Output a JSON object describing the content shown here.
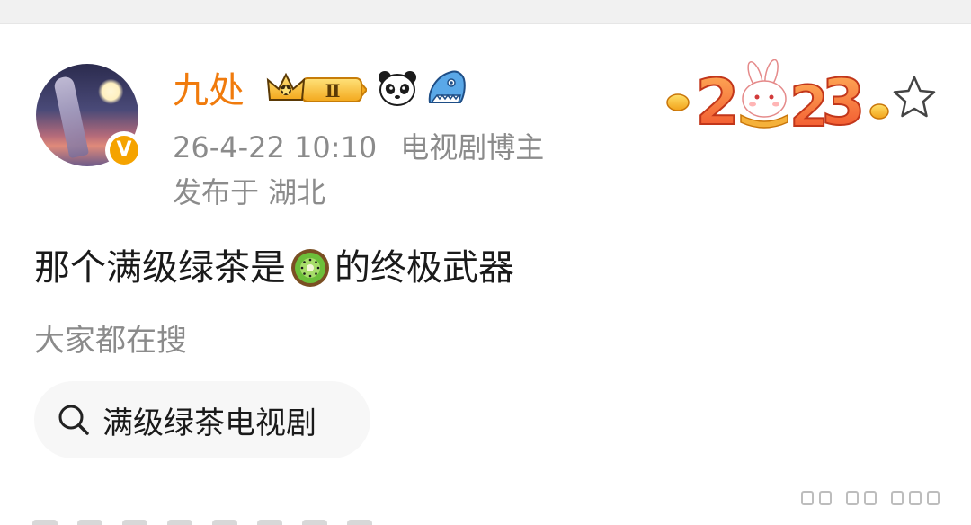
{
  "post": {
    "author": {
      "name": "九处",
      "verified_mark": "V",
      "level_badge": "Ⅱ"
    },
    "meta": {
      "timestamp": "26-4-22 10:10",
      "role": "电视剧博主",
      "location": "发布于 湖北"
    },
    "year_badge": "2023",
    "content": {
      "text_before": "那个满级绿茶是",
      "emoji": "kiwi-emoji",
      "text_after": "的终极武器"
    },
    "trending": {
      "label": "大家都在搜",
      "search_item": "满级绿茶电视剧"
    }
  },
  "icons": {
    "avatar": "avatar-image",
    "verified": "verified-badge-icon",
    "crown": "crown-badge-icon",
    "panda": "panda-icon",
    "shark": "shark-icon",
    "anniversary": "rabbit-2023-badge",
    "favorite": "star-icon",
    "search": "search-icon"
  },
  "colors": {
    "username": "#f07b0d",
    "meta_text": "#8b8b8b",
    "body_text": "#1a1a1a",
    "verified_badge": "#f5a300",
    "chip_bg": "#f7f7f7"
  }
}
